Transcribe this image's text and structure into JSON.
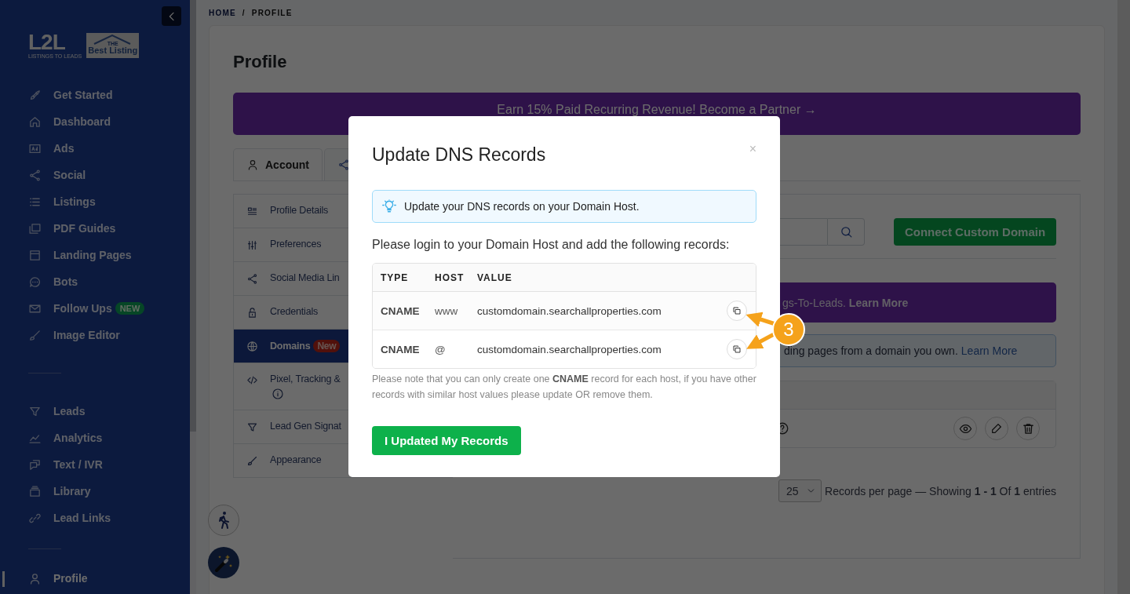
{
  "sidebar": {
    "logo": {
      "wordmark": "L2L",
      "tagline": "LISTINGS TO LEADS"
    },
    "partner_logo": {
      "small": "THE",
      "name": "Best Listing"
    },
    "nav_groups": [
      [
        {
          "label": "Get Started",
          "selected": false
        },
        {
          "label": "Dashboard",
          "selected": false
        },
        {
          "label": "Ads",
          "selected": false
        },
        {
          "label": "Social",
          "selected": false
        },
        {
          "label": "Listings",
          "selected": false
        },
        {
          "label": "PDF Guides",
          "selected": false
        },
        {
          "label": "Landing Pages",
          "selected": false
        },
        {
          "label": "Bots",
          "selected": false
        },
        {
          "label": "Follow Ups",
          "badge": "NEW",
          "selected": false
        },
        {
          "label": "Image Editor",
          "selected": false
        }
      ],
      [
        {
          "label": "Leads",
          "selected": false
        },
        {
          "label": "Analytics",
          "selected": false
        },
        {
          "label": "Text / IVR",
          "selected": false
        },
        {
          "label": "Library",
          "selected": false
        },
        {
          "label": "Lead Links",
          "selected": false
        }
      ],
      [
        {
          "label": "Profile",
          "selected": true
        }
      ]
    ]
  },
  "breadcrumb": {
    "items": [
      "HOME",
      "PROFILE"
    ],
    "separator": "/"
  },
  "page_title": "Profile",
  "partner_banner": "Earn 15% Paid Recurring Revenue! Become a Partner →",
  "tabs": [
    {
      "label": "Account",
      "selected": true
    },
    {
      "selected": false
    }
  ],
  "account_menu": [
    {
      "label": "Profile Details",
      "selected": false
    },
    {
      "label": "Preferences",
      "selected": false
    },
    {
      "label": "Social Media Lin",
      "selected": false
    },
    {
      "label": "Credentials",
      "selected": false
    },
    {
      "label": "Domains",
      "badge": "New",
      "selected": true
    },
    {
      "label": "Pixel, Tracking &",
      "info": true,
      "selected": false
    },
    {
      "label": "Lead Gen Signat",
      "selected": false
    },
    {
      "label": "Appearance",
      "selected": false
    }
  ],
  "domains": {
    "connect_button": "Connect Custom Domain",
    "promo_banner": "gs-To-Leads. **Learn More**",
    "info_alert": {
      "text": "ding pages from a domain you own.",
      "link": "Learn More"
    },
    "per_page": "25",
    "pagination": "Records per page — Showing **1 - 1** Of **1** entries"
  },
  "modal": {
    "title": "Update DNS Records",
    "close": "×",
    "alert": "Update your DNS records on your Domain Host.",
    "instructions": "Please login to your Domain Host and add the following records:",
    "columns": [
      "TYPE",
      "HOST",
      "VALUE"
    ],
    "records": [
      {
        "type": "CNAME",
        "host": "www",
        "value": "customdomain.searchallproperties.com"
      },
      {
        "type": "CNAME",
        "host": "@",
        "value": "customdomain.searchallproperties.com"
      }
    ],
    "note": "Please note that you can only create one **CNAME** record for each host, if you have other records with similar host values please update OR remove them.",
    "submit": "I Updated My Records"
  },
  "annotation": {
    "label": "3"
  }
}
